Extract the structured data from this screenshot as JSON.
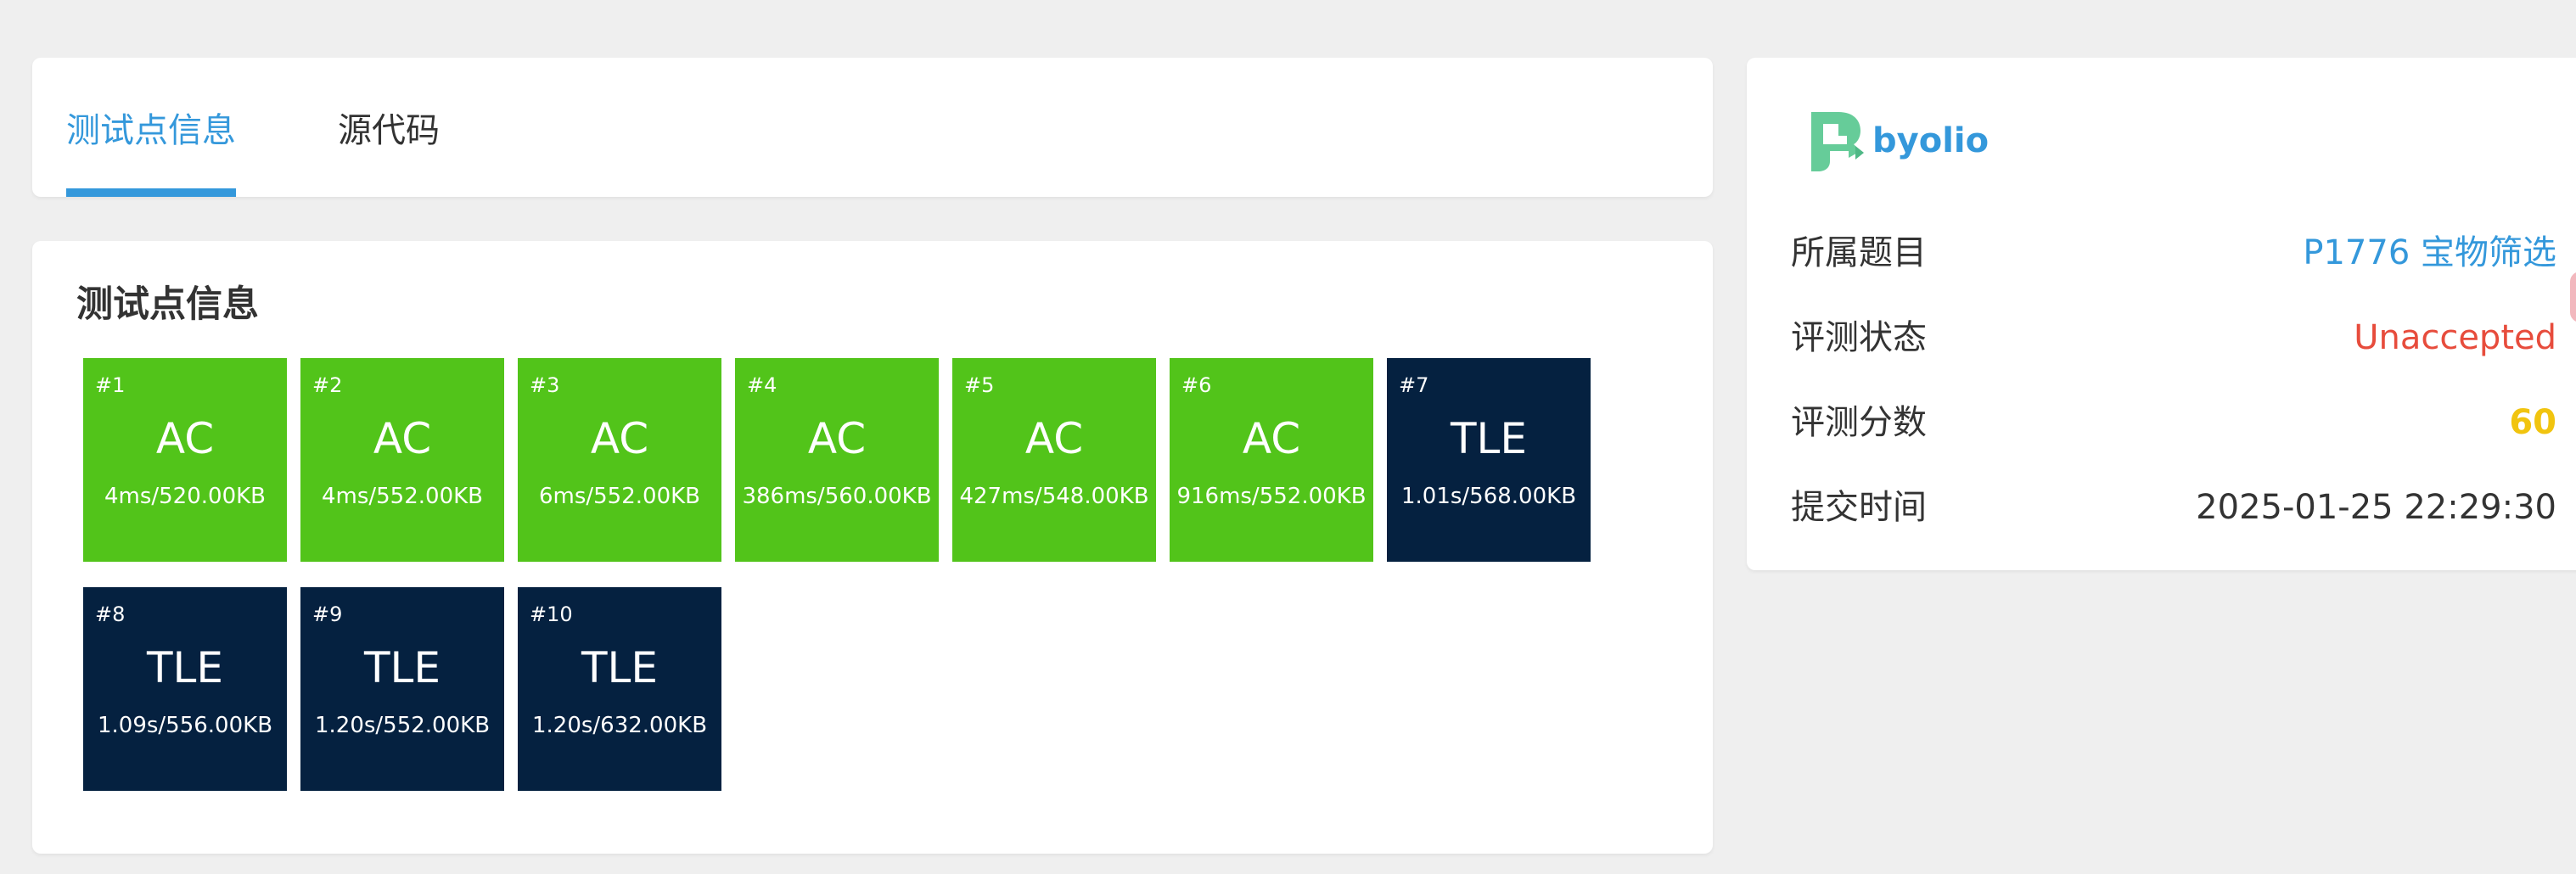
{
  "tabs": [
    {
      "label": "测试点信息",
      "active": true
    },
    {
      "label": "源代码",
      "active": false
    }
  ],
  "cases_title": "测试点信息",
  "colors": {
    "accent": "#3498db",
    "ac": "#52c41a",
    "tle": "#052140",
    "unaccepted": "#e74c3c",
    "score": "#f1c40f"
  },
  "cases": [
    {
      "num": "#1",
      "status": "AC",
      "info": "4ms/520.00KB"
    },
    {
      "num": "#2",
      "status": "AC",
      "info": "4ms/552.00KB"
    },
    {
      "num": "#3",
      "status": "AC",
      "info": "6ms/552.00KB"
    },
    {
      "num": "#4",
      "status": "AC",
      "info": "386ms/560.00KB"
    },
    {
      "num": "#5",
      "status": "AC",
      "info": "427ms/548.00KB"
    },
    {
      "num": "#6",
      "status": "AC",
      "info": "916ms/552.00KB"
    },
    {
      "num": "#7",
      "status": "TLE",
      "info": "1.01s/568.00KB"
    },
    {
      "num": "#8",
      "status": "TLE",
      "info": "1.09s/556.00KB"
    },
    {
      "num": "#9",
      "status": "TLE",
      "info": "1.20s/552.00KB"
    },
    {
      "num": "#10",
      "status": "TLE",
      "info": "1.20s/632.00KB"
    }
  ],
  "submission": {
    "user": {
      "name": "byolio",
      "avatar_icon": "user-avatar-icon"
    },
    "problem": {
      "label": "所属题目",
      "value": "P1776 宝物筛选"
    },
    "status": {
      "label": "评测状态",
      "value": "Unaccepted"
    },
    "score": {
      "label": "评测分数",
      "value": "60"
    },
    "time": {
      "label": "提交时间",
      "value": "2025-01-25 22:29:30"
    }
  }
}
